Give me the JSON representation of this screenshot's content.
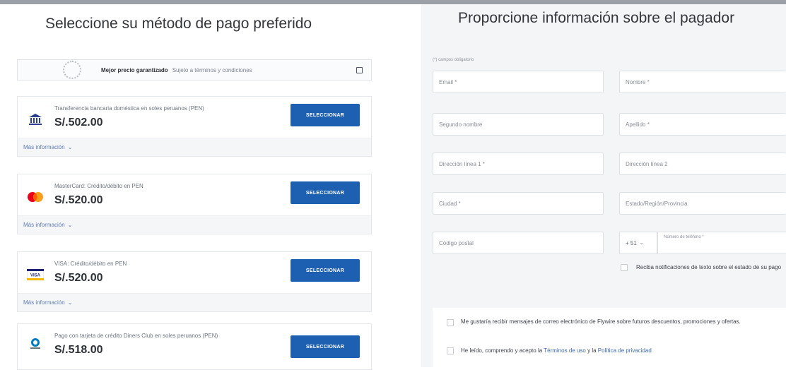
{
  "payment_methods": {
    "title": "Seleccione su método de pago preferido",
    "promo": {
      "strong": "Mejor precio garantizado",
      "sub": "Sujeto a términos y condiciones"
    },
    "button_label": "SELECCIONAR",
    "more_label": "Más información",
    "options": [
      {
        "description": "Transferencia bancaria doméstica en soles peruanos (PEN)",
        "price": "S/.502.00",
        "icon": "bank-icon"
      },
      {
        "description": "MasterCard: Crédito/débito en PEN",
        "price": "S/.520.00",
        "icon": "mastercard-icon"
      },
      {
        "description": "VISA: Crédito/débito en PEN",
        "price": "S/.520.00",
        "icon": "visa-icon"
      },
      {
        "description": "Pago con tarjeta de crédito Diners Club en soles peruanos (PEN)",
        "price": "S/.518.00",
        "icon": "diners-club-icon"
      }
    ]
  },
  "payer_info": {
    "title": "Proporcione información sobre el pagador",
    "required_note": "(*) campos obligatorio",
    "fields": {
      "email": "Email *",
      "first_name": "Nombre *",
      "middle_name": "Segundo nombre",
      "last_name": "Apellido *",
      "address1": "Dirección línea 1 *",
      "address2": "Dirección línea 2",
      "city": "Ciudad *",
      "state": "Estado/Región/Provincia",
      "postal": "Código postal",
      "phone_cc": "+ 51",
      "phone_label": "Número de teléfono *"
    },
    "sms_optin": "Reciba notificaciones de texto sobre el estado de su pago",
    "email_optin": "Me gustaría recibir mensajes de correo electrónico de Flywire sobre futuros descuentos, promociones y ofertas.",
    "terms_prefix": "He leído, comprendo y acepto la",
    "terms_link": "Términos de uso",
    "terms_and": "y la",
    "privacy_link": "Política de privacidad"
  }
}
